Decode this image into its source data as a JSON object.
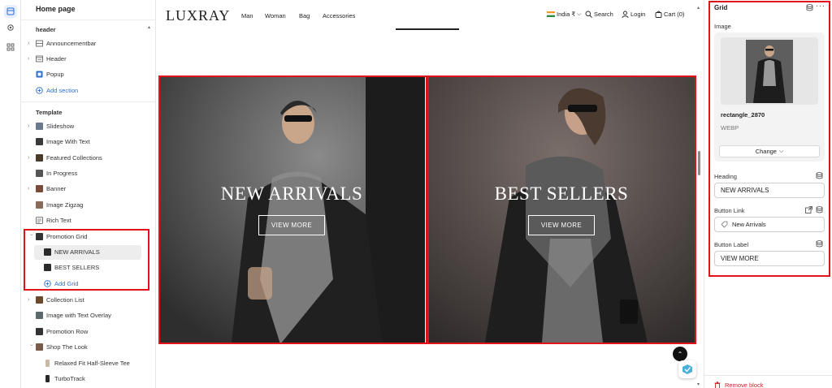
{
  "sidebar": {
    "title": "Home page",
    "header_section": "header",
    "template_section": "Template",
    "header_items": [
      {
        "label": "Announcementbar",
        "icon": "announcement-bar-icon"
      },
      {
        "label": "Header",
        "icon": "header-icon"
      },
      {
        "label": "Popup",
        "icon": "popup-icon"
      }
    ],
    "add_section": "Add section",
    "template_items": [
      {
        "label": "Slideshow"
      },
      {
        "label": "Image With Text"
      },
      {
        "label": "Featured Collections"
      },
      {
        "label": "In Progress"
      },
      {
        "label": "Banner"
      },
      {
        "label": "Image Zigzag"
      },
      {
        "label": "Rich Text"
      },
      {
        "label": "Promotion Grid"
      },
      {
        "label": "NEW ARRIVALS"
      },
      {
        "label": "BEST SELLERS"
      },
      {
        "label": "Add Grid"
      },
      {
        "label": "Collection List"
      },
      {
        "label": "Image with Text Overlay"
      },
      {
        "label": "Promotion Row"
      },
      {
        "label": "Shop The Look"
      },
      {
        "label": "Relaxed Fit Half-Sleeve Tee"
      },
      {
        "label": "TurboTrack"
      }
    ]
  },
  "storefront": {
    "logo": "LUXRAY",
    "nav": [
      "Man",
      "Woman",
      "Bag",
      "Accessories"
    ],
    "country": "India ₹",
    "search": "Search",
    "login": "Login",
    "cart": "Cart (0)",
    "panels": [
      {
        "title": "NEW ARRIVALS",
        "button": "VIEW MORE"
      },
      {
        "title": "BEST SELLERS",
        "button": "VIEW MORE"
      }
    ]
  },
  "inspector": {
    "title": "Grid",
    "image_label": "Image",
    "image_name": "rectangle_2870",
    "image_format": "WEBP",
    "change_button": "Change",
    "heading_label": "Heading",
    "heading_value": "NEW ARRIVALS",
    "button_link_label": "Button Link",
    "button_link_value": "New Arrivals",
    "button_label_label": "Button Label",
    "button_label_value": "VIEW MORE",
    "remove_block": "Remove block"
  },
  "colors": {
    "highlight": "#e0141a",
    "accent_blue": "#2c6ecb",
    "danger": "#c8242a"
  }
}
